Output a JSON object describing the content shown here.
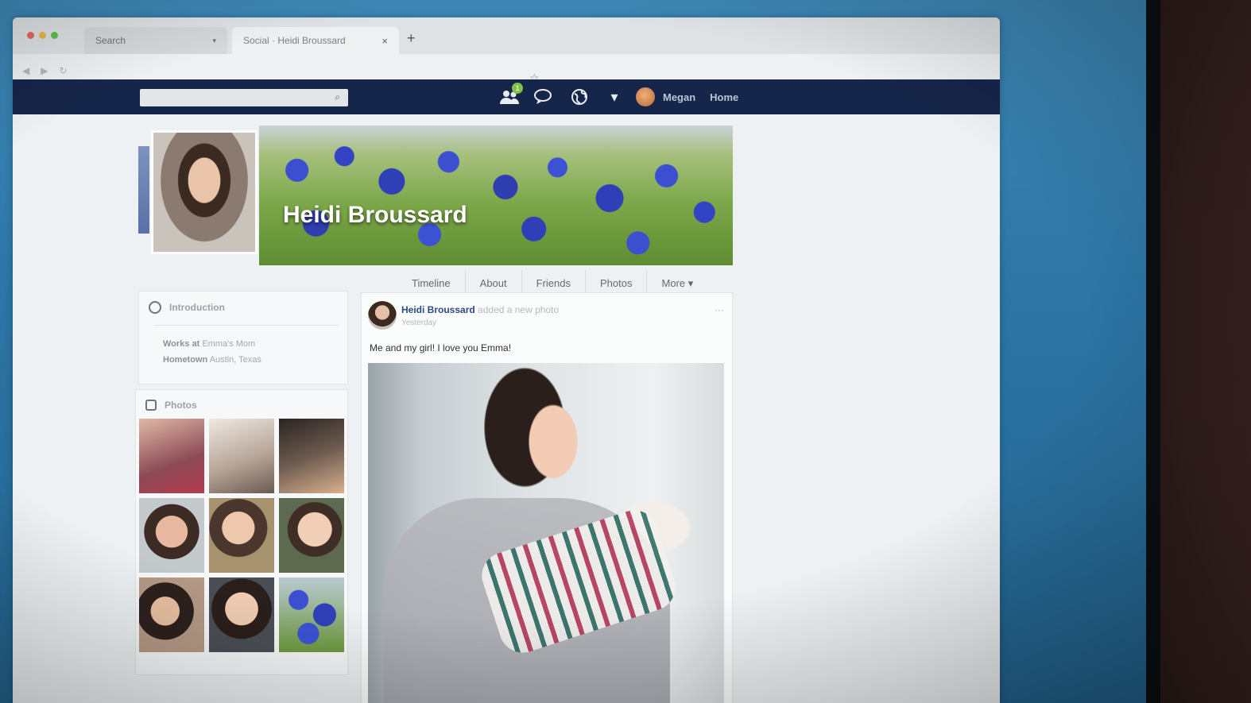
{
  "browser": {
    "tabs": [
      {
        "label": "Search"
      },
      {
        "label": "Social · Heidi Broussard",
        "close": "×"
      }
    ],
    "new_tab": "+"
  },
  "header": {
    "notification_count": "1",
    "user_name": "Megan",
    "home_label": "Home",
    "icons": [
      "friends-icon",
      "messages-icon",
      "globe-icon",
      "dropdown-icon",
      "search-icon"
    ],
    "colors": {
      "bar": "#16264a",
      "badge": "#7dc247"
    }
  },
  "profile": {
    "name": "Heidi Broussard",
    "tabs": [
      "Timeline",
      "About",
      "Friends",
      "Photos",
      "More"
    ]
  },
  "intro": {
    "title": "Introduction",
    "works_label": "Works at",
    "works_value": "Emma's Mom",
    "hometown_label": "Hometown",
    "hometown_value": "Austin, Texas"
  },
  "photos": {
    "title": "Photos"
  },
  "post": {
    "author": "Heidi Broussard",
    "action": "added a new photo",
    "time": "Yesterday",
    "more": "···",
    "text": "Me and my girl! I love you Emma!"
  }
}
